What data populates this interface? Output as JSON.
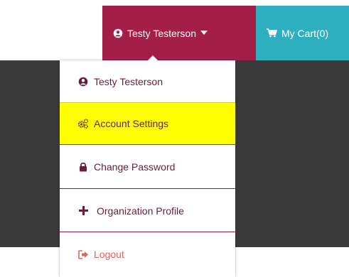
{
  "header": {
    "user_menu": {
      "label": "Testy Testerson",
      "icon": "user-circle-icon",
      "caret": "caret-down-icon",
      "color": "#a31f4a"
    },
    "cart": {
      "label": "My Cart(0)",
      "icon": "shopping-cart-icon",
      "color": "#2eafc0"
    }
  },
  "dropdown": {
    "items": [
      {
        "label": "Testy Testerson",
        "icon": "user-circle-icon"
      },
      {
        "label": "Account Settings",
        "icon": "gears-icon",
        "highlight": "#ffff00"
      },
      {
        "label": "Change Password",
        "icon": "lock-icon"
      },
      {
        "label": "Organization Profile",
        "icon": "plus-icon"
      },
      {
        "label": "Logout",
        "icon": "sign-out-icon",
        "color": "#e0645a"
      }
    ]
  },
  "colors": {
    "background_dark": "#3a3a3a",
    "menu_text": "#6a1d3a",
    "divider": "#8b1f44"
  }
}
